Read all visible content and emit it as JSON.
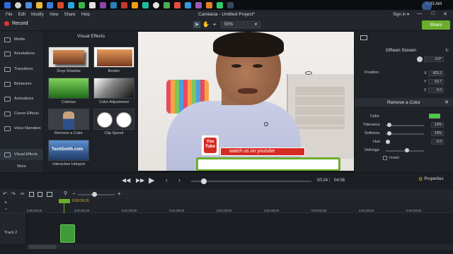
{
  "taskbar": {
    "time": "6:33 AM"
  },
  "menu": {
    "items": [
      "File",
      "Edit",
      "Modify",
      "View",
      "Share",
      "Help"
    ],
    "title": "Camtasia - Untitled Project*",
    "signin": "Sign in ▾"
  },
  "toolbar": {
    "record_label": "Record",
    "zoom_value": "50%",
    "share_label": "Share"
  },
  "sidebar": {
    "items": [
      "Media",
      "Annotations",
      "Transitions",
      "Behaviors",
      "Animations",
      "Cursor Effects",
      "Voice Narration",
      "Visual Effects",
      "More"
    ]
  },
  "effects": {
    "title": "Visual Effects",
    "items": [
      "Drop Shadow",
      "Border",
      "Colorize",
      "Color Adjustment",
      "Remove a Color",
      "Clip Speed",
      "Interactive Hotspot"
    ],
    "hotspot_thumb_text": "TechSmith.com"
  },
  "video": {
    "youtube_label": "You\nTube",
    "banner_text": "watch us on youtube"
  },
  "properties": {
    "section_title": "GReen Screen",
    "rotation_value": "0.0°",
    "position_label": "Position:",
    "x_value": "423.2",
    "y_value": "53.7",
    "z_value": "0.0",
    "axes": [
      "X",
      "Y",
      "Z"
    ],
    "remove_color_title": "Remove a Color",
    "color_label": "Color",
    "color_swatch": "#3fd43a",
    "tolerance_label": "Tolerance",
    "tolerance_value": "10%",
    "tolerance_level": 0.1,
    "softness_label": "Softness",
    "softness_value": "10%",
    "softness_level": 0.1,
    "hue_label": "Hue",
    "hue_value": "0.0",
    "defringe_label": "Defringe",
    "defringe_level": 0.55,
    "invert_label": "Invert"
  },
  "playback": {
    "current_time": "00:24",
    "total_time": "04:08",
    "progress": 0.1,
    "properties_label": "Properties"
  },
  "timeline": {
    "playhead_time": "0:00:24;15",
    "ruler_ticks": [
      "0:00:00;00",
      "0:00:30;00",
      "0:01:00;00",
      "0:01:30;00",
      "0:02:00;00",
      "0:02:30;00",
      "0:03:00;00",
      "0:03:30;00",
      "0:04:00;00"
    ],
    "track_name": "Track 2"
  },
  "colors": {
    "accent_green": "#6cae2b",
    "record_red": "#e0352b",
    "youtube_red": "#d62b22"
  }
}
